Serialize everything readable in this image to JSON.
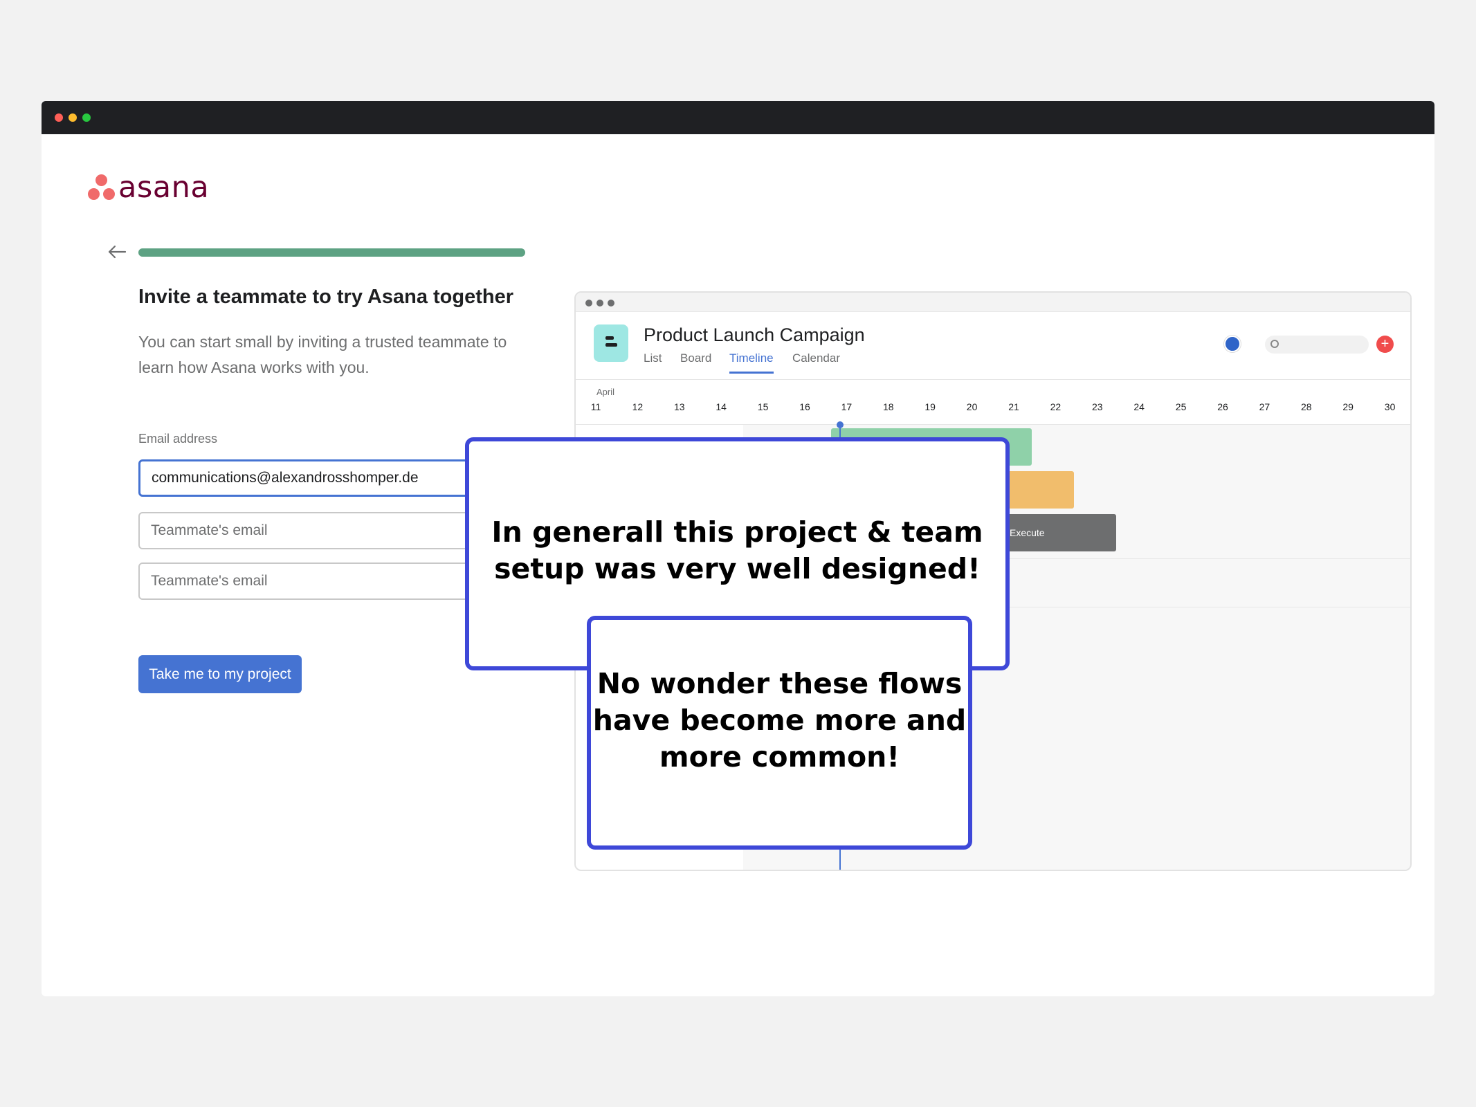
{
  "brand": {
    "name": "asana",
    "logo_color": "#690031",
    "mark_color": "#f06a6a"
  },
  "onboarding": {
    "progress": 1.0,
    "heading": "Invite a teammate to try Asana together",
    "subtext": "You can start small by inviting a trusted teammate to learn how Asana works with you.",
    "email_label": "Email address",
    "emails": [
      {
        "value": "communications@alexandrosshomper.de",
        "placeholder": ""
      },
      {
        "value": "",
        "placeholder": "Teammate's email"
      },
      {
        "value": "",
        "placeholder": "Teammate's email"
      }
    ],
    "cta_label": "Take me to my project",
    "accent_color": "#4573d2"
  },
  "preview": {
    "project_title": "Product Launch Campaign",
    "tabs": [
      "List",
      "Board",
      "Timeline",
      "Calendar"
    ],
    "active_tab": "Timeline",
    "month": "April",
    "days": [
      "11",
      "12",
      "13",
      "14",
      "15",
      "16",
      "17",
      "18",
      "19",
      "20",
      "21",
      "22",
      "23",
      "24",
      "25",
      "26",
      "27",
      "28",
      "29",
      "30"
    ],
    "task_label": "Execute"
  },
  "callouts": {
    "first": "In generall this project & team setup was very well designed!",
    "second": "No wonder these flows have become more and more common!",
    "border_color": "#3e48d8"
  }
}
